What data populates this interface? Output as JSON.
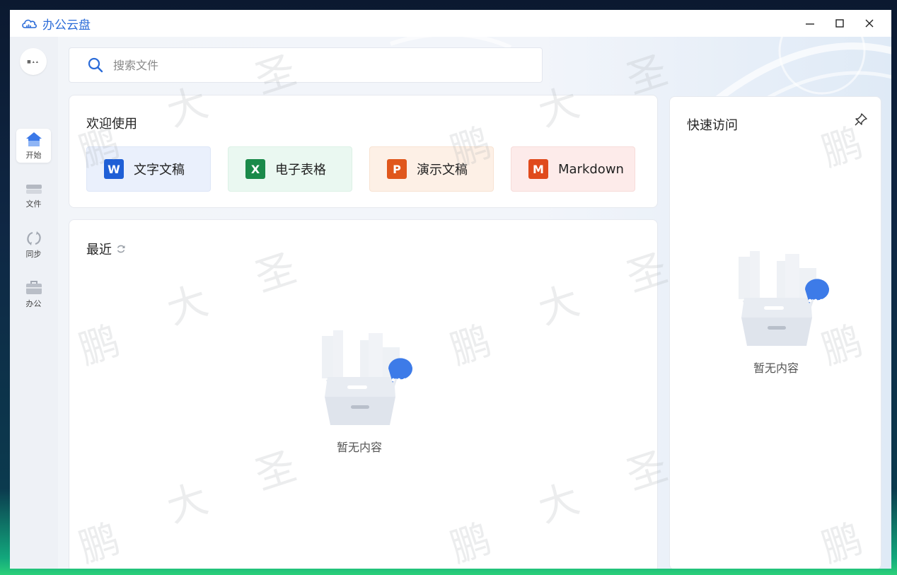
{
  "app": {
    "title": "办公云盘"
  },
  "sidebar": {
    "items": [
      {
        "label": "开始",
        "icon": "home-icon"
      },
      {
        "label": "文件",
        "icon": "drive-icon"
      },
      {
        "label": "同步",
        "icon": "sync-icon"
      },
      {
        "label": "办公",
        "icon": "briefcase-icon"
      }
    ]
  },
  "search": {
    "placeholder": "搜索文件"
  },
  "welcome": {
    "title": "欢迎使用",
    "tiles": [
      {
        "badge": "W",
        "label": "文字文稿",
        "color": "#1f5fd6"
      },
      {
        "badge": "X",
        "label": "电子表格",
        "color": "#1a8a4a"
      },
      {
        "badge": "P",
        "label": "演示文稿",
        "color": "#e0571c"
      },
      {
        "badge": "M",
        "label": "Markdown",
        "color": "#e04a1c"
      }
    ]
  },
  "recent": {
    "title": "最近",
    "empty_text": "暂无内容"
  },
  "quick_access": {
    "title": "快速访问",
    "empty_text": "暂无内容"
  },
  "watermark": {
    "chars": [
      "鹏",
      "大",
      "圣"
    ]
  },
  "colors": {
    "accent": "#2a6bd8",
    "bubble": "#3d7be8"
  }
}
